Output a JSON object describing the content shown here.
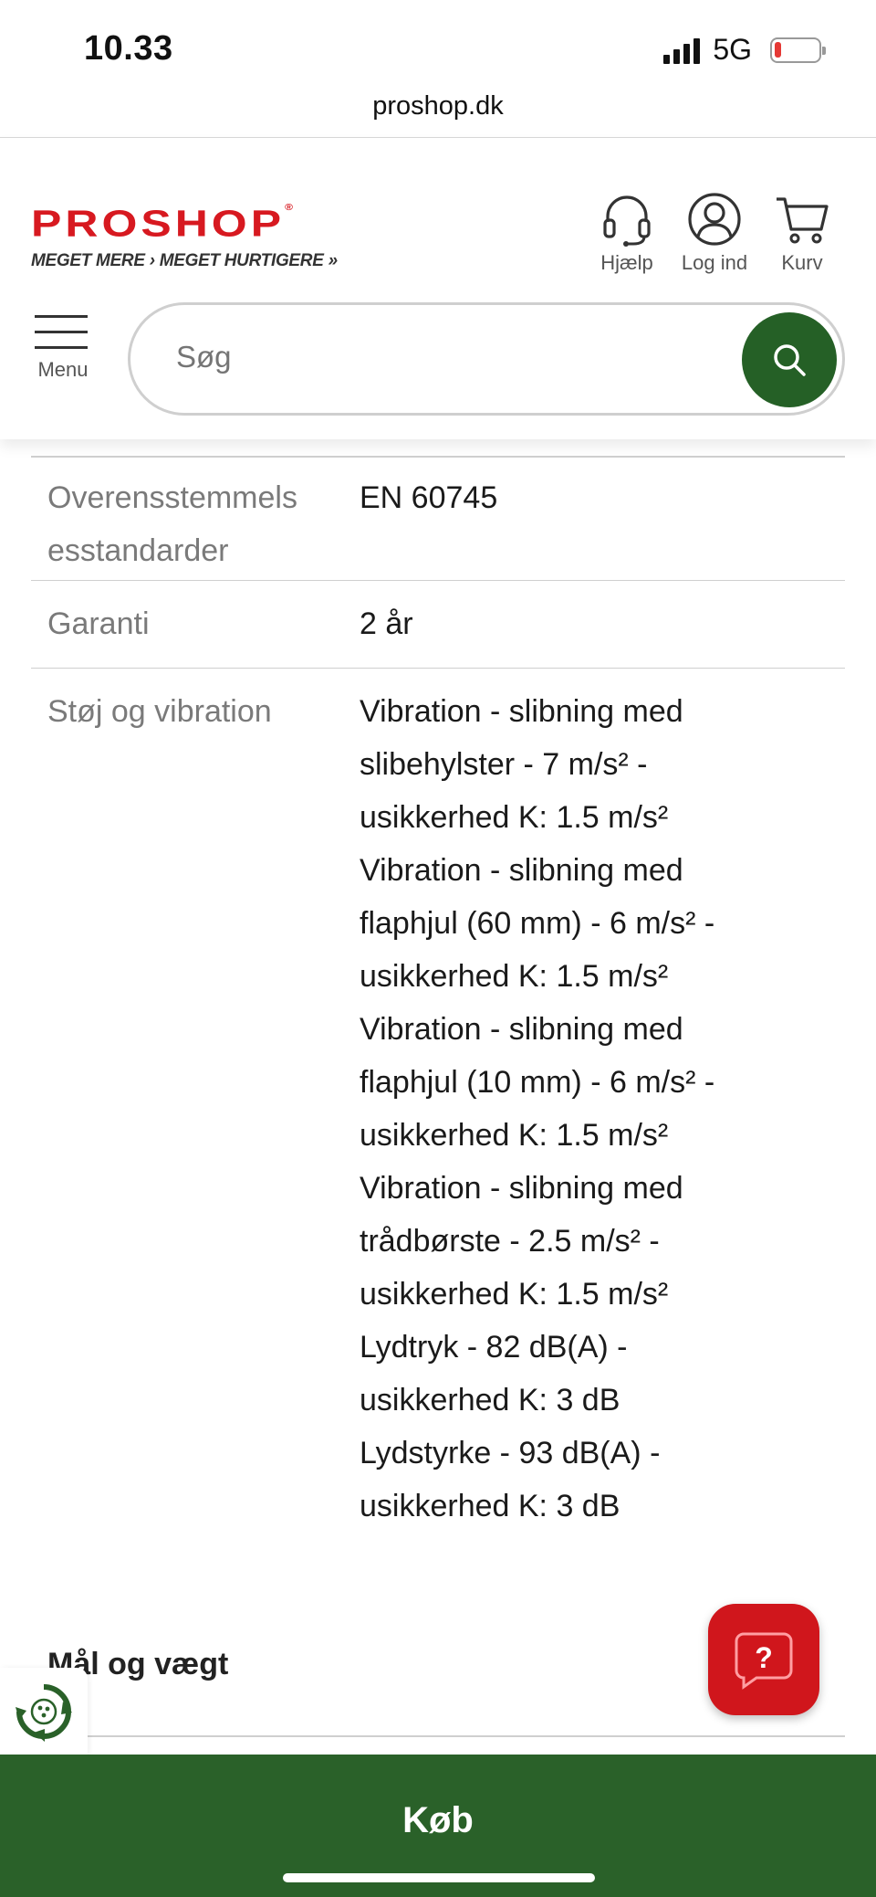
{
  "status_bar": {
    "time": "10.33",
    "network": "5G",
    "battery_level": 0.15,
    "battery_color": "#e53935"
  },
  "browser": {
    "url": "proshop.dk"
  },
  "header": {
    "logo_text": "PROSHOP",
    "logo_tagline": "MEGET MERE › MEGET HURTIGERE »",
    "brand_color": "#d71920",
    "help_label": "Hjælp",
    "login_label": "Log ind",
    "cart_label": "Kurv",
    "menu_label": "Menu",
    "help_icon": "headset-icon",
    "login_icon": "user-circle-icon",
    "cart_icon": "cart-icon",
    "menu_icon": "hamburger-icon"
  },
  "search": {
    "placeholder": "Søg",
    "button_icon": "search-icon",
    "button_color": "#256026"
  },
  "specs": {
    "rows": [
      {
        "label_line1": "Overensstemmels",
        "label_line2": "esstandarder",
        "value": "EN 60745"
      },
      {
        "label": "Garanti",
        "value": "2 år"
      },
      {
        "label": "Støj og vibration",
        "value_lines": [
          "Vibration - slibning med",
          "slibehylster - 7 m/s² -",
          "usikkerhed K: 1.5 m/s²",
          "Vibration - slibning med",
          "flaphjul (60 mm) - 6 m/s² -",
          "usikkerhed K: 1.5 m/s²",
          "Vibration - slibning med",
          "flaphjul (10 mm) - 6 m/s² -",
          "usikkerhed K: 1.5 m/s²",
          "Vibration - slibning med",
          "trådbørste - 2.5 m/s² -",
          "usikkerhed K: 1.5 m/s²",
          "Lydtryk - 82 dB(A) -",
          "usikkerhed K: 3 dB",
          "Lydstyrke - 93 dB(A) -",
          "usikkerhed K: 3 dB"
        ]
      }
    ]
  },
  "section": {
    "title": "Mål og vægt"
  },
  "fab": {
    "help_symbol": "?",
    "color": "#d0161c"
  },
  "buy_bar": {
    "label": "Køb",
    "color": "#2a6129"
  }
}
